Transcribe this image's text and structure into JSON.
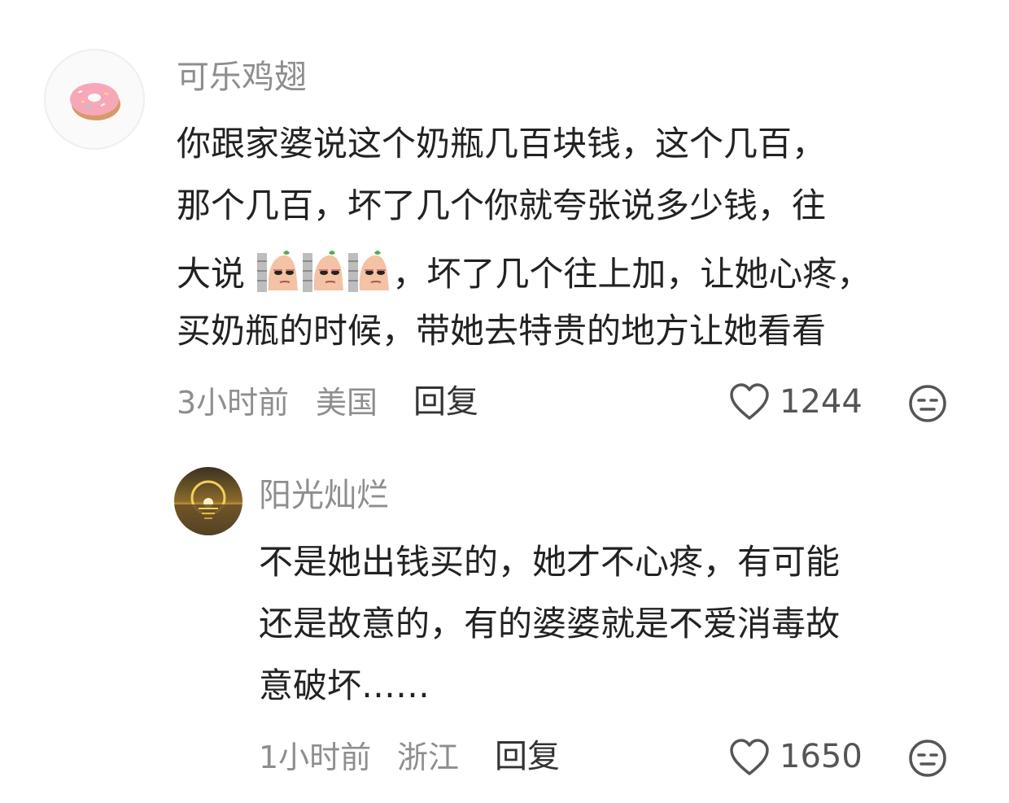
{
  "comments": [
    {
      "username": "可乐鸡翅",
      "lines": [
        "你跟家婆说这个奶瓶几百块钱，这个几百，",
        "那个几百，坏了几个你就夸张说多少钱，往",
        "大说",
        "，坏了几个往上加，让她心疼，",
        "买奶瓶的时候，带她去特贵的地方让她看看"
      ],
      "time": "3小时前",
      "location": "美国",
      "reply_label": "回复",
      "likes": "1244",
      "avatar_icon": "donut-icon",
      "emoji_icon": "sausage-sideeye-emoji"
    },
    {
      "username": "阳光灿烂",
      "lines": [
        "不是她出钱买的，她才不心疼，有可能",
        "还是故意的，有的婆婆就是不爱消毒故",
        "意破坏……"
      ],
      "time": "1小时前",
      "location": "浙江",
      "reply_label": "回复",
      "likes": "1650",
      "avatar_icon": "sunset-icon"
    }
  ],
  "colors": {
    "username": "#8e8e8e",
    "text": "#222222",
    "meta": "#8e8e8e",
    "icon": "#555555"
  }
}
